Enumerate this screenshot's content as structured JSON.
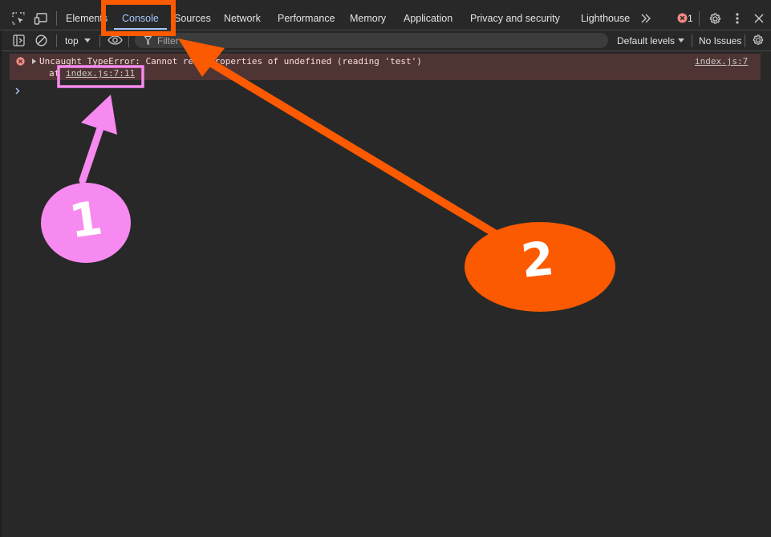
{
  "tabs": [
    {
      "label": "Elements"
    },
    {
      "label": "Console",
      "active": true
    },
    {
      "label": "Sources"
    },
    {
      "label": "Network"
    },
    {
      "label": "Performance"
    },
    {
      "label": "Memory"
    },
    {
      "label": "Application"
    },
    {
      "label": "Privacy and security"
    },
    {
      "label": "Lighthouse"
    }
  ],
  "header": {
    "more_tabs_icon": "double-chevron-right-icon",
    "error_count": "1",
    "settings_icon": "gear-icon",
    "menu_icon": "kebab-menu-icon",
    "close_icon": "close-icon"
  },
  "toolbar": {
    "context": "top",
    "filter_placeholder": "Filter",
    "levels": "Default levels",
    "issues": "No Issues"
  },
  "console": {
    "error_message": "Uncaught TypeError: Cannot read properties of undefined (reading 'test')",
    "stack_prefix": "at ",
    "stack_link": "index.js:7:11",
    "source_link": "index.js:7"
  },
  "annotations": {
    "badge_1": "1",
    "badge_2": "2",
    "color_pink": "#f78af0",
    "color_orange": "#fb5a00"
  },
  "colors": {
    "background": "#282828",
    "accent": "#a8c7fa",
    "error_background": "#4e3534",
    "error_icon": "#f28b82"
  }
}
